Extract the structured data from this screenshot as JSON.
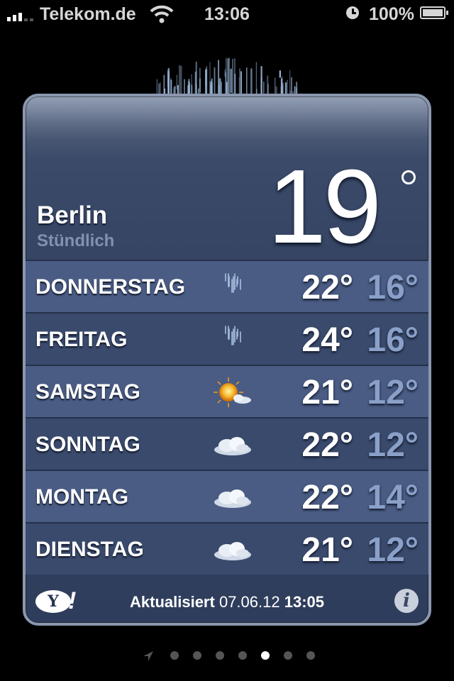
{
  "status_bar": {
    "carrier": "Telekom.de",
    "time": "13:06",
    "battery": "100%"
  },
  "weather": {
    "city": "Berlin",
    "mode": "Stündlich",
    "current_temp": "19",
    "forecast": [
      {
        "day": "DONNERSTAG",
        "high": "22°",
        "low": "16°",
        "icon": "rain-icon"
      },
      {
        "day": "FREITAG",
        "high": "24°",
        "low": "16°",
        "icon": "rain-icon"
      },
      {
        "day": "SAMSTAG",
        "high": "21°",
        "low": "12°",
        "icon": "sun-cloud-icon"
      },
      {
        "day": "SONNTAG",
        "high": "22°",
        "low": "12°",
        "icon": "cloud-icon"
      },
      {
        "day": "MONTAG",
        "high": "22°",
        "low": "14°",
        "icon": "cloud-icon"
      },
      {
        "day": "DIENSTAG",
        "high": "21°",
        "low": "12°",
        "icon": "cloud-icon"
      }
    ],
    "footer": {
      "yahoo": "Y",
      "yahoo_bang": "!",
      "updated_label": "Aktualisiert",
      "updated_date": "07.06.12",
      "updated_time": "13:05",
      "info": "i"
    }
  },
  "page_indicator": {
    "pages": 7,
    "active": 5
  }
}
